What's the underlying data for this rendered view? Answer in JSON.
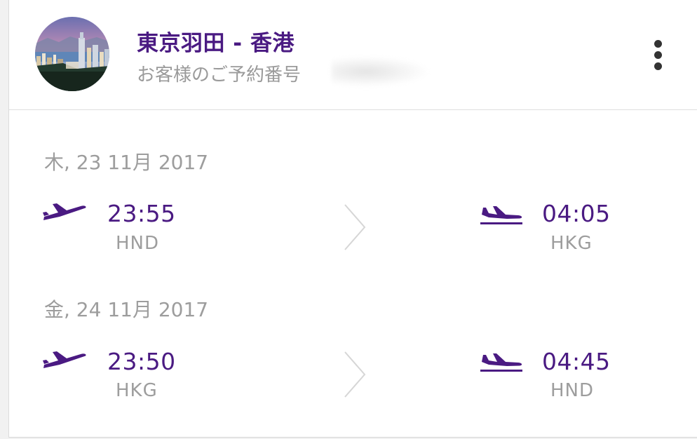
{
  "header": {
    "route_title": "東京羽田 - 香港",
    "booking_label": "お客様のご予約番号"
  },
  "colors": {
    "brand_purple": "#4a1a82",
    "muted_text": "#9d9d9d",
    "card_bg": "#ffffff"
  },
  "flights": [
    {
      "date": "木, 23 11月 2017",
      "departure": {
        "time": "23:55",
        "airport": "HND"
      },
      "arrival": {
        "time": "04:05",
        "airport": "HKG"
      }
    },
    {
      "date": "金, 24 11月 2017",
      "departure": {
        "time": "23:50",
        "airport": "HKG"
      },
      "arrival": {
        "time": "04:45",
        "airport": "HND"
      }
    }
  ],
  "icons": {
    "menu": "more-vertical-icon",
    "takeoff": "plane-takeoff-icon",
    "landing": "plane-landing-icon",
    "arrow": "chevron-right-icon"
  }
}
